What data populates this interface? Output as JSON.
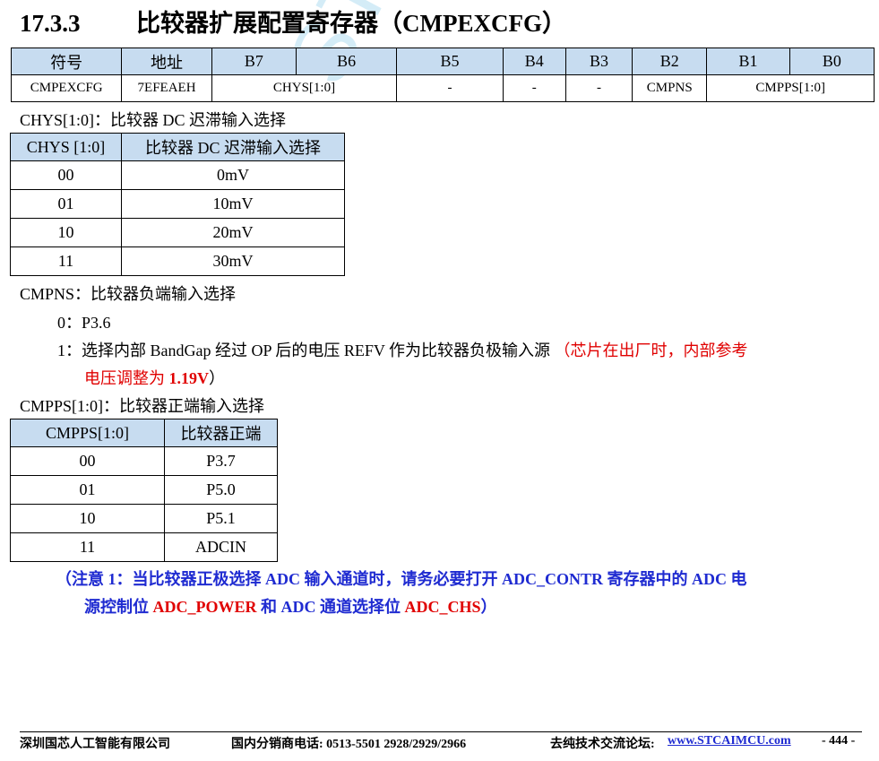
{
  "watermark": "STCMCU",
  "heading": {
    "number": "17.3.3",
    "title": "比较器扩展配置寄存器（CMPEXCFG）"
  },
  "register_table": {
    "headers": [
      "符号",
      "地址",
      "B7",
      "B6",
      "B5",
      "B4",
      "B3",
      "B2",
      "B1",
      "B0"
    ],
    "row": {
      "symbol": "CMPEXCFG",
      "address": "7EFEAEH",
      "chys": "CHYS[1:0]",
      "b5": "-",
      "b4": "-",
      "b3": "-",
      "b2": "CMPNS",
      "cmpps": "CMPPS[1:0]"
    }
  },
  "chys": {
    "desc": "CHYS[1:0]：比较器 DC 迟滞输入选择",
    "headers": [
      "CHYS [1:0]",
      "比较器 DC 迟滞输入选择"
    ],
    "rows": [
      [
        "00",
        "0mV"
      ],
      [
        "01",
        "10mV"
      ],
      [
        "10",
        "20mV"
      ],
      [
        "11",
        "30mV"
      ]
    ]
  },
  "cmpns": {
    "desc": "CMPNS：比较器负端输入选择",
    "opt0": "0：P3.6",
    "opt1": "1：选择内部 BandGap 经过 OP 后的电压 REFV 作为比较器负极输入源",
    "note_a": "（芯片在出厂时，内部参考",
    "note_b": "电压调整为",
    "note_val": "1.19V",
    "note_end": "）"
  },
  "cmpps": {
    "desc": "CMPPS[1:0]：比较器正端输入选择",
    "headers": [
      "CMPPS[1:0]",
      "比较器正端"
    ],
    "rows": [
      [
        "00",
        "P3.7"
      ],
      [
        "01",
        "P5.0"
      ],
      [
        "10",
        "P5.1"
      ],
      [
        "11",
        "ADCIN"
      ]
    ]
  },
  "note": {
    "line1": "（注意 1：当比较器正极选择 ADC 输入通道时，请务必要打开 ADC_CONTR 寄存器中的 ADC 电",
    "line2_a": "源控制位",
    "line2_b": "ADC_POWER",
    "line2_c": "和 ADC 通道选择位",
    "line2_d": "ADC_CHS",
    "line2_e": "）"
  },
  "footer": {
    "company": "深圳国芯人工智能有限公司",
    "hotline": "国内分销商电话: 0513-5501 2928/2929/2966",
    "forum_label": "去纯技术交流论坛:",
    "forum_url": "www.STCAIMCU.com",
    "page": "- 444 -"
  }
}
